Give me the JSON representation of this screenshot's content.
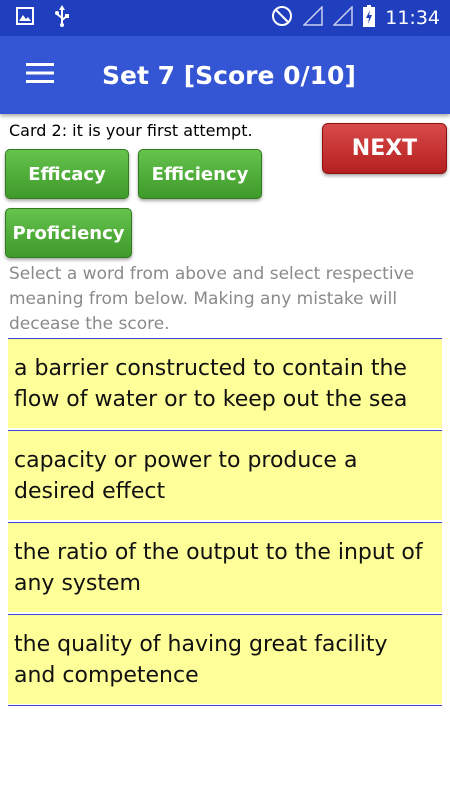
{
  "status_bar": {
    "time": "11:34",
    "icons": [
      "image-icon",
      "usb-icon",
      "do-not-disturb-icon",
      "no-signal-icon",
      "no-signal-icon",
      "battery-charging-icon"
    ]
  },
  "app_bar": {
    "menu_icon": "hamburger-menu-icon",
    "title": "Set 7 [Score 0/10]"
  },
  "card_info": "Card 2: it is your first attempt.",
  "next_label": "NEXT",
  "words": [
    "Efficacy",
    "Efficiency",
    "Proficiency"
  ],
  "instructions": "Select a word from above and select respective meaning from below. Making any mistake will decease the score.",
  "meanings": [
    "a barrier constructed to contain the flow of water or to keep out the sea",
    "capacity or power to produce a desired effect",
    "the ratio of the output to the input of any system",
    "the quality of having great facility and competence"
  ],
  "colors": {
    "status_bar": "#1f3fbf",
    "app_bar": "#3556d4",
    "next_button": "#c62828",
    "word_button": "#4caf37",
    "meaning_background": "#ffff99",
    "divider": "#3d45d8"
  }
}
